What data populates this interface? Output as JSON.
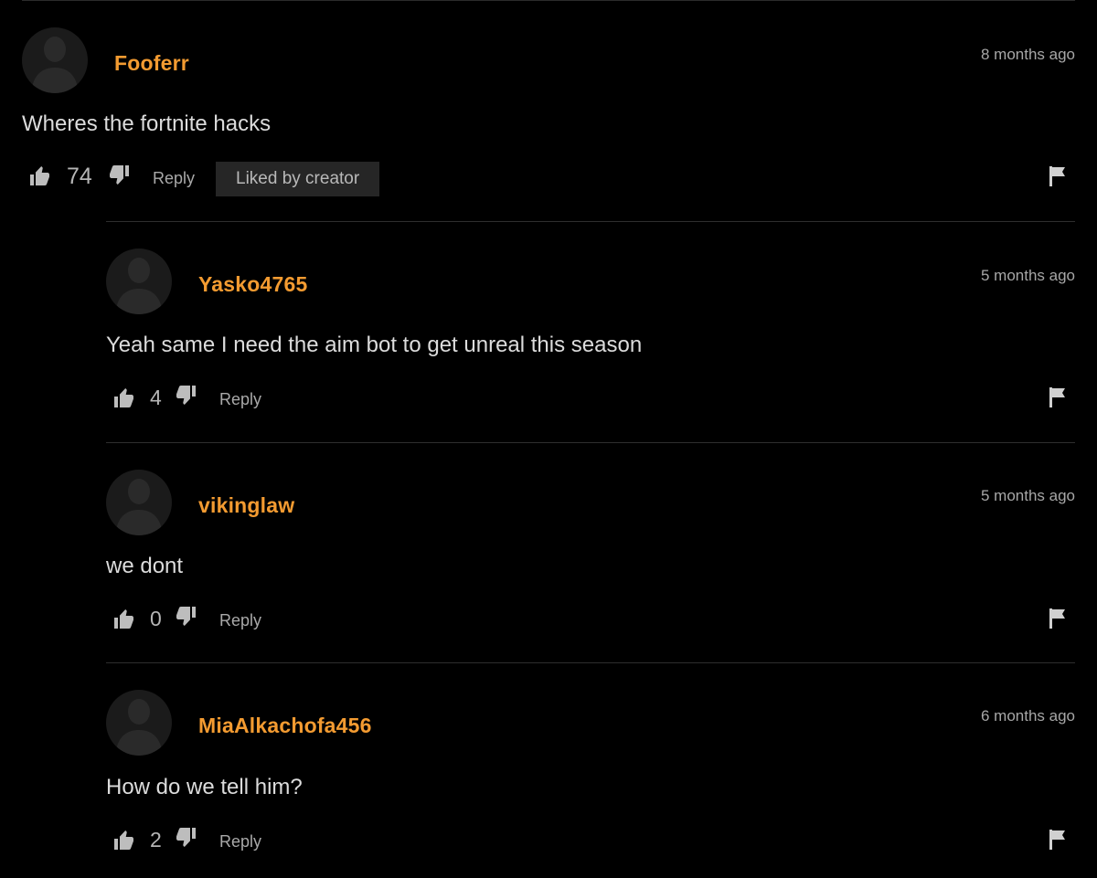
{
  "colors": {
    "background": "#000000",
    "username": "#f39b31",
    "divider": "#2e2e2e",
    "badge_background": "#262626"
  },
  "icons": {
    "like": "thumbs-up-icon",
    "dislike": "thumbs-down-icon",
    "flag": "flag-icon",
    "avatar": "default-user-silhouette"
  },
  "comments": [
    {
      "username": "Fooferr",
      "timestamp": "8 months ago",
      "text": "Wheres the fortnite hacks",
      "likes": "74",
      "reply_label": "Reply",
      "badge": "Liked by creator"
    },
    {
      "username": "Yasko4765",
      "timestamp": "5 months ago",
      "text": "Yeah same I need the aim bot to get unreal this season",
      "likes": "4",
      "reply_label": "Reply"
    },
    {
      "username": "vikinglaw",
      "timestamp": "5 months ago",
      "text": "we dont",
      "likes": "0",
      "reply_label": "Reply"
    },
    {
      "username": "MiaAlkachofa456",
      "timestamp": "6 months ago",
      "text": "How do we tell him?",
      "likes": "2",
      "reply_label": "Reply"
    }
  ]
}
